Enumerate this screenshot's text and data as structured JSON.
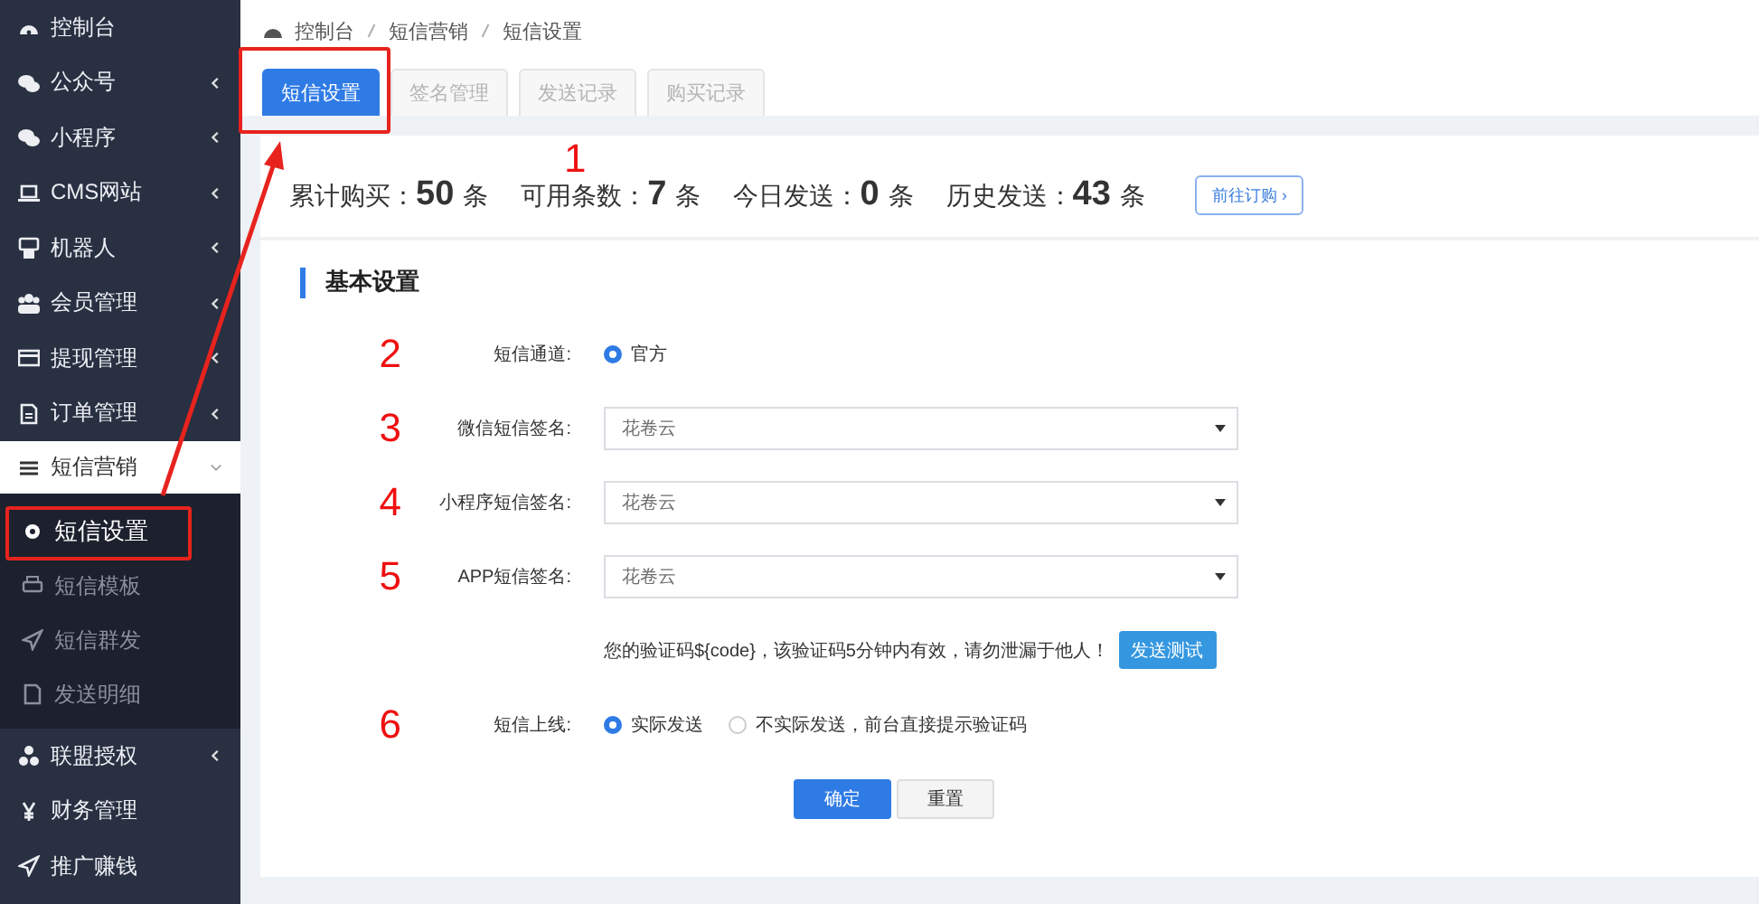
{
  "sidebar": {
    "items": [
      {
        "label": "控制台"
      },
      {
        "label": "公众号",
        "expanded": false
      },
      {
        "label": "小程序",
        "expanded": false
      },
      {
        "label": "CMS网站",
        "expanded": false
      },
      {
        "label": "机器人",
        "expanded": false
      },
      {
        "label": "会员管理",
        "expanded": false
      },
      {
        "label": "提现管理",
        "expanded": false
      },
      {
        "label": "订单管理",
        "expanded": false
      },
      {
        "label": "短信营销",
        "expanded": true,
        "children": [
          {
            "label": "短信设置",
            "selected": true,
            "highlighted": true
          },
          {
            "label": "短信模板",
            "selected": false,
            "highlighted": false
          },
          {
            "label": "短信群发",
            "selected": false,
            "highlighted": false
          },
          {
            "label": "发送明细",
            "selected": false,
            "highlighted": false
          }
        ]
      },
      {
        "label": "联盟授权",
        "expanded": false
      },
      {
        "label": "财务管理"
      },
      {
        "label": "推广赚钱"
      }
    ]
  },
  "breadcrumb": [
    "控制台",
    "短信营销",
    "短信设置"
  ],
  "tabs": [
    {
      "label": "短信设置",
      "selected": true,
      "highlighted": true
    },
    {
      "label": "签名管理",
      "selected": false,
      "highlighted": false
    },
    {
      "label": "发送记录",
      "selected": false,
      "highlighted": false
    },
    {
      "label": "购买记录",
      "selected": false,
      "highlighted": false
    }
  ],
  "stats": {
    "marker": "1",
    "items": [
      {
        "label": "累计购买：",
        "value": "50",
        "unit": "条"
      },
      {
        "label": "可用条数：",
        "value": "7",
        "unit": "条"
      },
      {
        "label": "今日发送：",
        "value": "0",
        "unit": "条"
      },
      {
        "label": "历史发送：",
        "value": "43",
        "unit": "条"
      }
    ],
    "button": "前往订购 ›"
  },
  "section_title": "基本设置",
  "form": [
    {
      "kind": "radio",
      "marker": "2",
      "label": "短信通道:",
      "options": [
        {
          "label": "官方",
          "selected": true
        }
      ]
    },
    {
      "kind": "select",
      "marker": "3",
      "label": "微信短信签名:",
      "value": "花卷云"
    },
    {
      "kind": "select",
      "marker": "4",
      "label": "小程序短信签名:",
      "value": "花卷云"
    },
    {
      "kind": "select",
      "marker": "5",
      "label": "APP短信签名:",
      "value": "花卷云"
    },
    {
      "kind": "note",
      "text": "您的验证码${code}，该验证码5分钟内有效，请勿泄漏于他人！",
      "button": "发送测试"
    },
    {
      "kind": "radio",
      "marker": "6",
      "label": "短信上线:",
      "options": [
        {
          "label": "实际发送",
          "selected": true
        },
        {
          "label": "不实际发送，前台直接提示验证码",
          "selected": false
        }
      ]
    }
  ],
  "actions": [
    {
      "label": "确定",
      "kind": "primary"
    },
    {
      "label": "重置",
      "kind": "default"
    }
  ]
}
